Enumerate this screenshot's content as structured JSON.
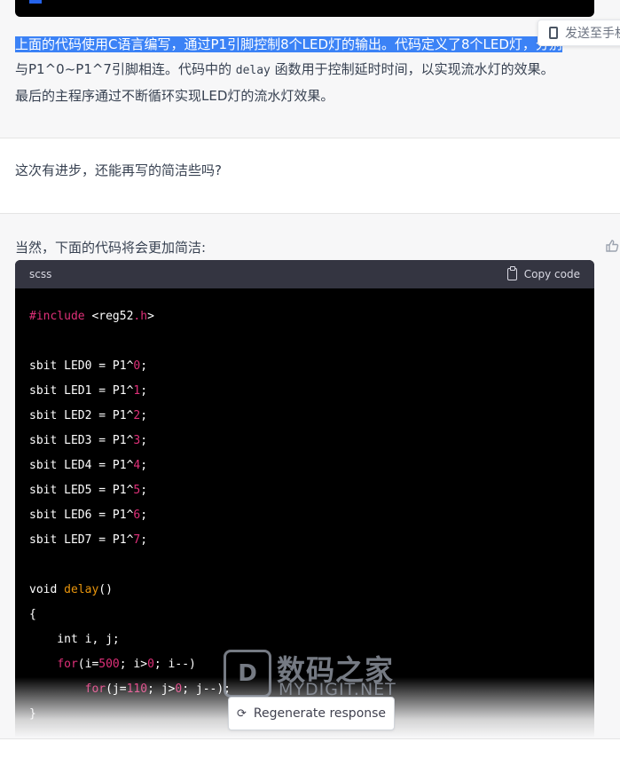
{
  "first_message": {
    "paragraph_highlight": "上面的代码使用C语言编写，通过P1引脚控制8个LED灯的输出。代码定义了8个LED灯，分别",
    "paragraph_part2": "与P1^0~P1^7引脚相连。代码中的 ",
    "paragraph_code": "delay",
    "paragraph_part3": " 函数用于控制延时时间，以实现流水灯的效果。",
    "paragraph_line3": "最后的主程序通过不断循环实现LED灯的流水灯效果。"
  },
  "send_to_phone": {
    "label": "发送至手机"
  },
  "user_message": {
    "text": "这次有进步，还能再写的简洁些吗?"
  },
  "second_message": {
    "intro": "当然，下面的代码将会更加简洁:",
    "code_language": "scss",
    "copy_label": "Copy code",
    "code_lines": [
      {
        "parts": [
          {
            "t": "#include",
            "c": "kw-red"
          },
          {
            "t": " <reg52",
            "c": ""
          },
          {
            "t": ".h",
            "c": "kw-red"
          },
          {
            "t": ">",
            "c": ""
          }
        ]
      },
      {
        "parts": []
      },
      {
        "parts": [
          {
            "t": "sbit LED0 = P1^",
            "c": ""
          },
          {
            "t": "0",
            "c": "num-red"
          },
          {
            "t": ";",
            "c": ""
          }
        ]
      },
      {
        "parts": [
          {
            "t": "sbit LED1 = P1^",
            "c": ""
          },
          {
            "t": "1",
            "c": "num-red"
          },
          {
            "t": ";",
            "c": ""
          }
        ]
      },
      {
        "parts": [
          {
            "t": "sbit LED2 = P1^",
            "c": ""
          },
          {
            "t": "2",
            "c": "num-red"
          },
          {
            "t": ";",
            "c": ""
          }
        ]
      },
      {
        "parts": [
          {
            "t": "sbit LED3 = P1^",
            "c": ""
          },
          {
            "t": "3",
            "c": "num-red"
          },
          {
            "t": ";",
            "c": ""
          }
        ]
      },
      {
        "parts": [
          {
            "t": "sbit LED4 = P1^",
            "c": ""
          },
          {
            "t": "4",
            "c": "num-red"
          },
          {
            "t": ";",
            "c": ""
          }
        ]
      },
      {
        "parts": [
          {
            "t": "sbit LED5 = P1^",
            "c": ""
          },
          {
            "t": "5",
            "c": "num-red"
          },
          {
            "t": ";",
            "c": ""
          }
        ]
      },
      {
        "parts": [
          {
            "t": "sbit LED6 = P1^",
            "c": ""
          },
          {
            "t": "6",
            "c": "num-red"
          },
          {
            "t": ";",
            "c": ""
          }
        ]
      },
      {
        "parts": [
          {
            "t": "sbit LED7 = P1^",
            "c": ""
          },
          {
            "t": "7",
            "c": "num-red"
          },
          {
            "t": ";",
            "c": ""
          }
        ]
      },
      {
        "parts": []
      },
      {
        "parts": [
          {
            "t": "void ",
            "c": ""
          },
          {
            "t": "delay",
            "c": "kw-orange"
          },
          {
            "t": "()",
            "c": ""
          }
        ]
      },
      {
        "parts": [
          {
            "t": "{",
            "c": ""
          }
        ]
      },
      {
        "parts": [
          {
            "t": "    int i, j;",
            "c": ""
          }
        ]
      },
      {
        "parts": [
          {
            "t": "    ",
            "c": ""
          },
          {
            "t": "for",
            "c": "kw-red"
          },
          {
            "t": "(i=",
            "c": ""
          },
          {
            "t": "500",
            "c": "num-red"
          },
          {
            "t": "; i>",
            "c": ""
          },
          {
            "t": "0",
            "c": "num-red"
          },
          {
            "t": "; i--)",
            "c": ""
          }
        ]
      },
      {
        "parts": [
          {
            "t": "        ",
            "c": ""
          },
          {
            "t": "for",
            "c": "kw-red"
          },
          {
            "t": "(j=",
            "c": ""
          },
          {
            "t": "110",
            "c": "num-red"
          },
          {
            "t": "; j>",
            "c": ""
          },
          {
            "t": "0",
            "c": "num-red"
          },
          {
            "t": "; j--);",
            "c": ""
          }
        ]
      },
      {
        "parts": [
          {
            "t": "}",
            "c": ""
          }
        ]
      }
    ]
  },
  "regenerate": {
    "label": "Regenerate response"
  },
  "watermark": {
    "cn": "数码之家",
    "en": "MYDIGIT.NET",
    "logo_letter": "D"
  },
  "colors": {
    "highlight": "#3b82f6",
    "code_bg": "#000000",
    "code_header": "#343541",
    "keyword_red": "#df3079",
    "keyword_orange": "#e9950c"
  }
}
